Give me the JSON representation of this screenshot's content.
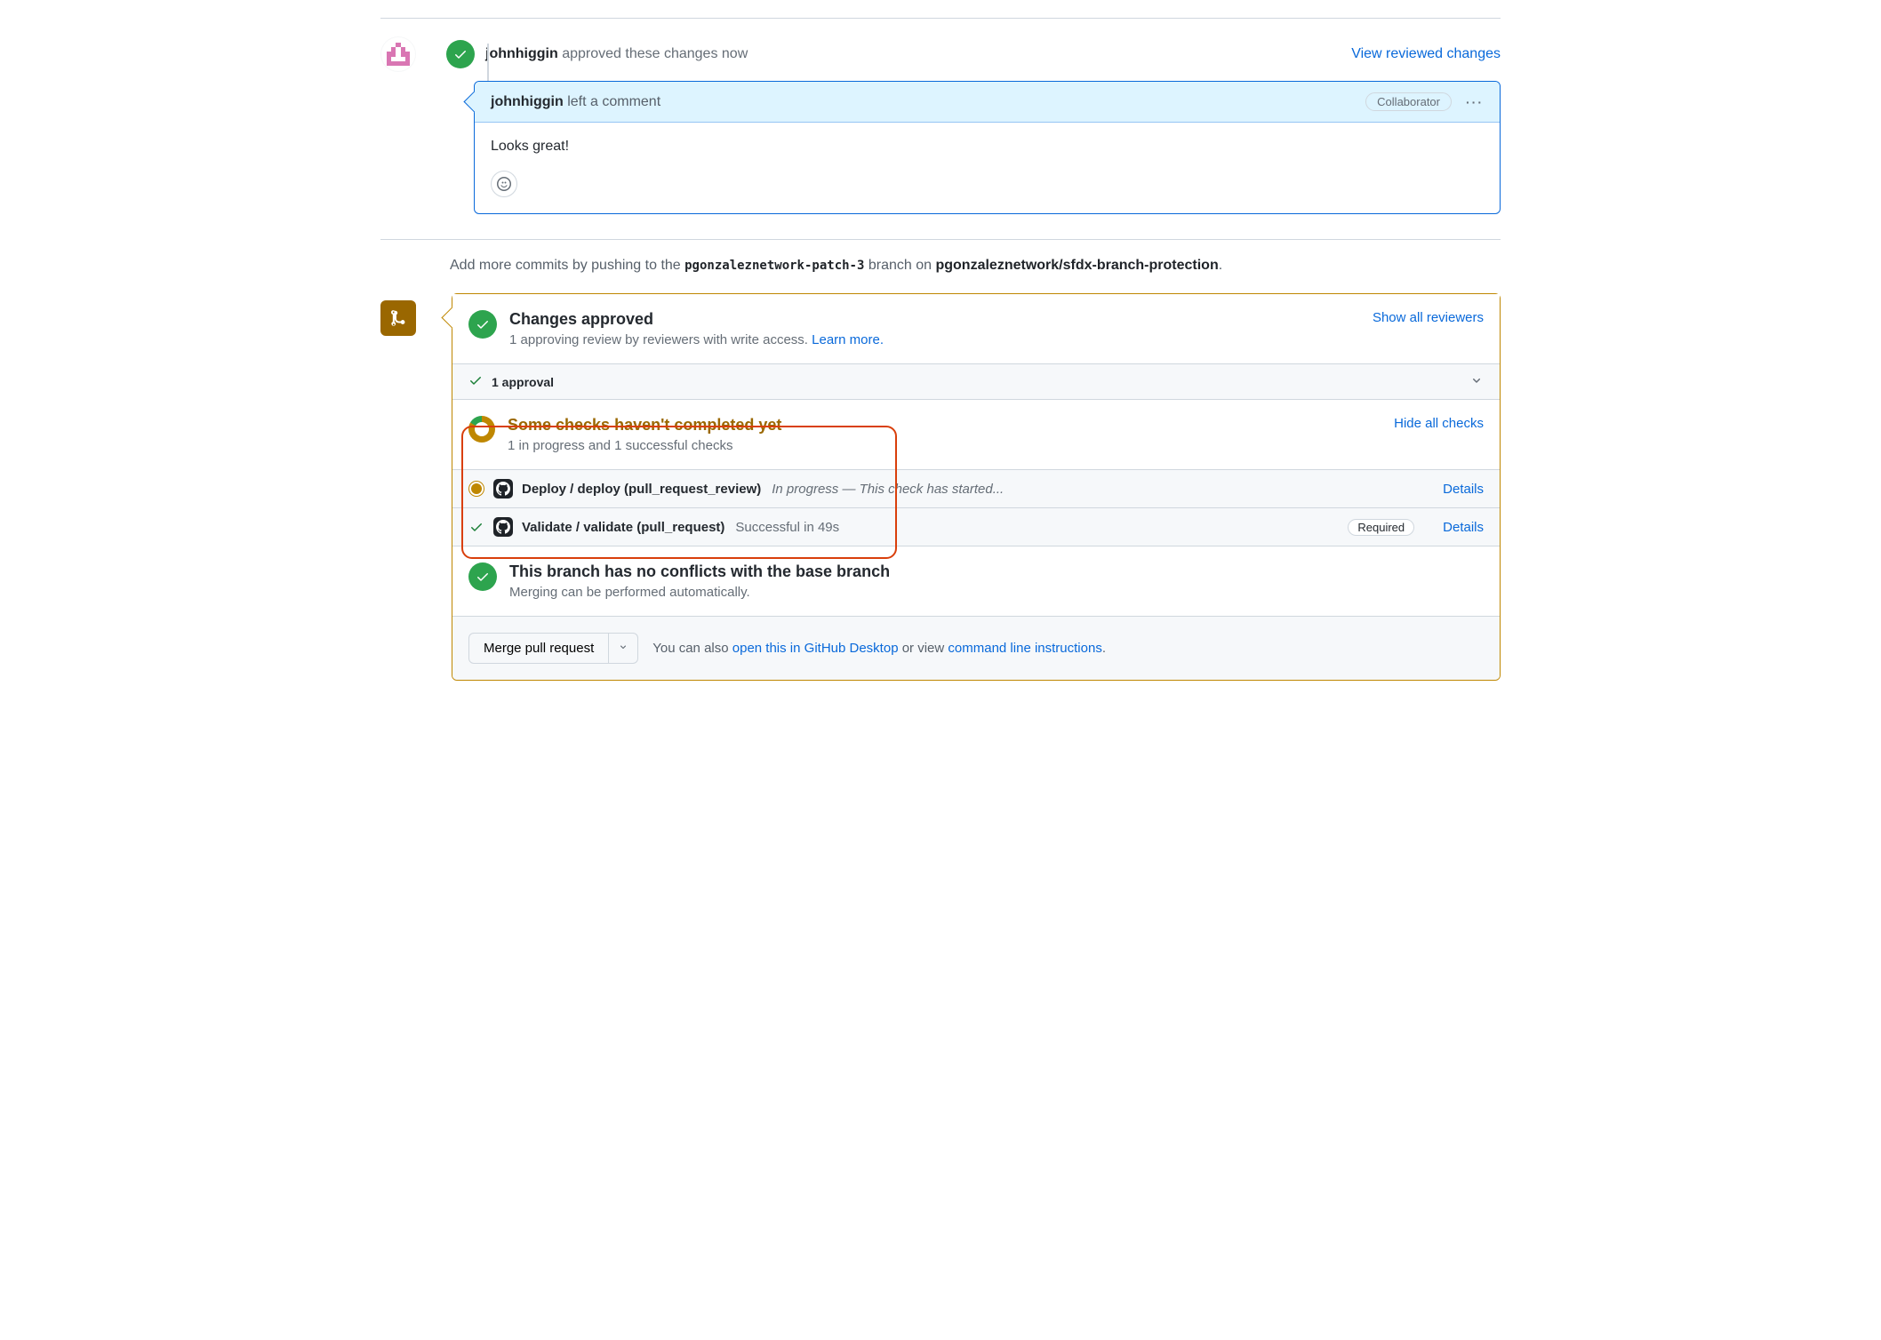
{
  "review": {
    "user": "johnhiggin",
    "action": "approved these changes",
    "when": "now",
    "viewLink": "View reviewed changes",
    "commentHeader": "left a comment",
    "roleBadge": "Collaborator",
    "body": "Looks great!"
  },
  "pushHint": {
    "prefix": "Add more commits by pushing to the ",
    "branch": "pgonzaleznetwork-patch-3",
    "mid": " branch on ",
    "repo": "pgonzaleznetwork/sfdx-branch-protection",
    "suffix": "."
  },
  "merge": {
    "approved": {
      "title": "Changes approved",
      "sub": "1 approving review by reviewers with write access. ",
      "learn": "Learn more.",
      "showAll": "Show all reviewers",
      "approvalCount": "1 approval"
    },
    "checks": {
      "title": "Some checks haven't completed yet",
      "sub": "1 in progress and 1 successful checks",
      "hideAll": "Hide all checks",
      "rows": [
        {
          "status": "pending",
          "name": "Deploy / deploy (pull_request_review)",
          "meta": "In progress — This check has started...",
          "required": false,
          "details": "Details"
        },
        {
          "status": "success",
          "name": "Validate / validate (pull_request)",
          "meta": "Successful in 49s",
          "required": true,
          "details": "Details"
        }
      ]
    },
    "conflicts": {
      "title": "This branch has no conflicts with the base branch",
      "sub": "Merging can be performed automatically."
    },
    "footer": {
      "mergeBtn": "Merge pull request",
      "textA": "You can also ",
      "linkA": "open this in GitHub Desktop",
      "textB": " or view ",
      "linkB": "command line instructions",
      "textC": "."
    }
  }
}
